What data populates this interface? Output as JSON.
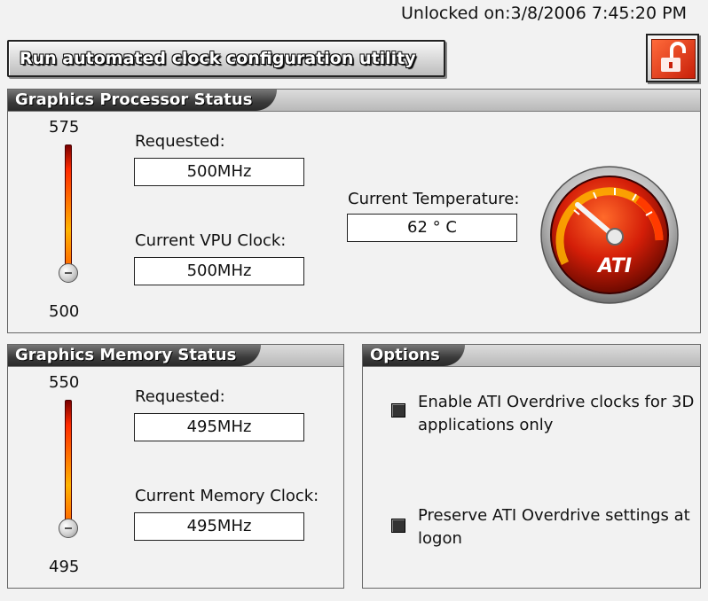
{
  "header": {
    "unlocked_text": "Unlocked on:3/8/2006 7:45:20 PM",
    "run_button_label": "Run automated clock configuration utility",
    "lock_icon": "unlocked-padlock-icon"
  },
  "gpu_status": {
    "title": "Graphics Processor Status",
    "slider_max": "575",
    "slider_min": "500",
    "slider_value": 0,
    "requested_label": "Requested:",
    "requested_value": "500MHz",
    "current_label": "Current VPU Clock:",
    "current_value": "500MHz",
    "temperature_label": "Current Temperature:",
    "temperature_value": "62 ° C",
    "gauge_brand": "ATI"
  },
  "memory_status": {
    "title": "Graphics Memory Status",
    "slider_max": "550",
    "slider_min": "495",
    "slider_value": 0,
    "requested_label": "Requested:",
    "requested_value": "495MHz",
    "current_label": "Current Memory Clock:",
    "current_value": "495MHz"
  },
  "options": {
    "title": "Options",
    "items": [
      {
        "label": "Enable ATI Overdrive clocks for 3D applications only",
        "checked": false
      },
      {
        "label": "Preserve ATI Overdrive settings at logon",
        "checked": false
      }
    ]
  },
  "colors": {
    "accent": "#e03010",
    "panel_header_dark": "#2a2a2a",
    "background": "#f2f2f2"
  }
}
